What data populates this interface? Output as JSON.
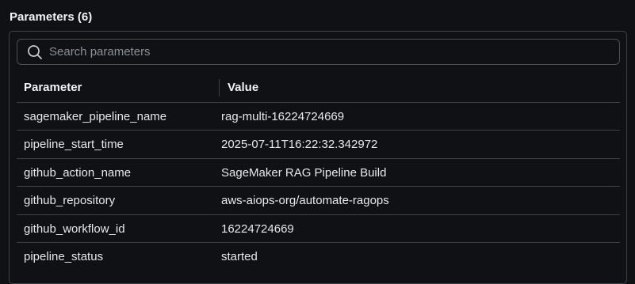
{
  "section": {
    "title": "Parameters (6)"
  },
  "search": {
    "icon": "search-icon",
    "placeholder": "Search parameters",
    "value": ""
  },
  "table": {
    "headers": {
      "parameter": "Parameter",
      "value": "Value"
    },
    "rows": [
      {
        "parameter": "sagemaker_pipeline_name",
        "value": "rag-multi-16224724669"
      },
      {
        "parameter": "pipeline_start_time",
        "value": "2025-07-11T16:22:32.342972"
      },
      {
        "parameter": "github_action_name",
        "value": "SageMaker RAG Pipeline Build"
      },
      {
        "parameter": "github_repository",
        "value": "aws-aiops-org/automate-ragops"
      },
      {
        "parameter": "github_workflow_id",
        "value": "16224724669"
      },
      {
        "parameter": "pipeline_status",
        "value": "started"
      }
    ]
  },
  "colors": {
    "background": "#0f1114",
    "border": "#3d4249",
    "text": "#e6e8eb",
    "placeholder": "#8a9099"
  }
}
